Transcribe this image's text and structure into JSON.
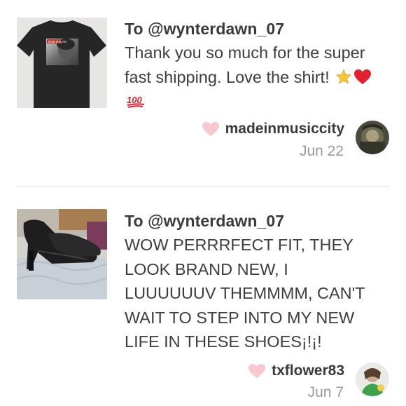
{
  "reviews": [
    {
      "to": "To @wynterdawn_07",
      "message": "Thank you so much for the super fast shipping. Love the shirt!",
      "emojis": [
        "star-emoji",
        "red-heart-emoji",
        "hundred-points-emoji"
      ],
      "emoji_hundred_text": "100",
      "username": "madeinmusiccity",
      "date": "Jun 22",
      "thumbnail": "black-tshirt-photo",
      "thumbnail_text": "BOB DYLAN"
    },
    {
      "to": "To @wynterdawn_07",
      "message": "WOW PERRRFECT FIT, THEY LOOK BRAND NEW, I LUUUUUUV THEMMMM, CAN'T WAIT TO STEP INTO MY NEW LIFE IN THESE SHOES¡!¡!",
      "username": "txflower83",
      "date": "Jun 7",
      "thumbnail": "black-heels-photo"
    }
  ],
  "colors": {
    "heart_pink": "#f7c9cf",
    "date_gray": "#9a9a9a",
    "text_dark": "#3a3a3a",
    "divider": "#e3e3e3"
  }
}
